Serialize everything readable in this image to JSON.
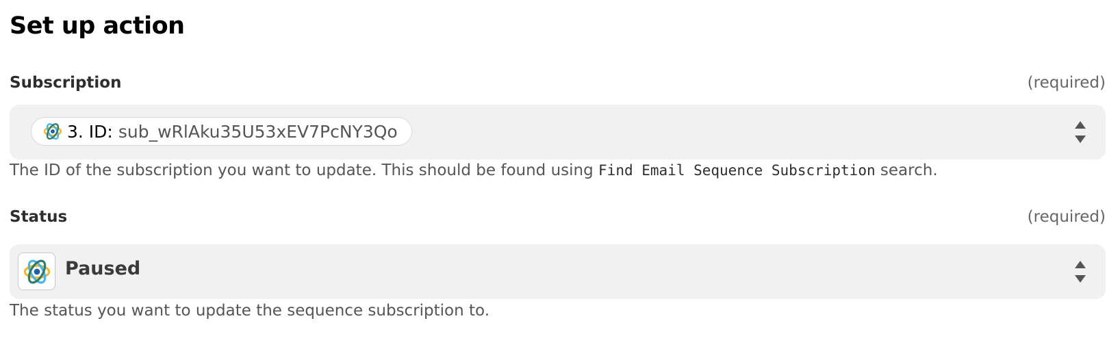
{
  "page": {
    "title": "Set up action"
  },
  "fields": {
    "subscription": {
      "label": "Subscription",
      "required": "(required)",
      "pill_prefix": "3. ID:",
      "pill_value": "sub_wRlAku35U53xEV7PcNY3Qo",
      "help_before": "The ID of the subscription you want to update. This should be found using ",
      "help_code": "Find Email Sequence Subscription",
      "help_after": " search."
    },
    "status": {
      "label": "Status",
      "required": "(required)",
      "value": "Paused",
      "help": "The status you want to update the sequence subscription to."
    }
  },
  "icons": {
    "app_icon": "app-logo-icon",
    "stepper": "up-down-arrows-icon"
  },
  "colors": {
    "field_background": "#f1f1f1",
    "label_text": "#2d2e2e",
    "muted_text": "#666666"
  }
}
